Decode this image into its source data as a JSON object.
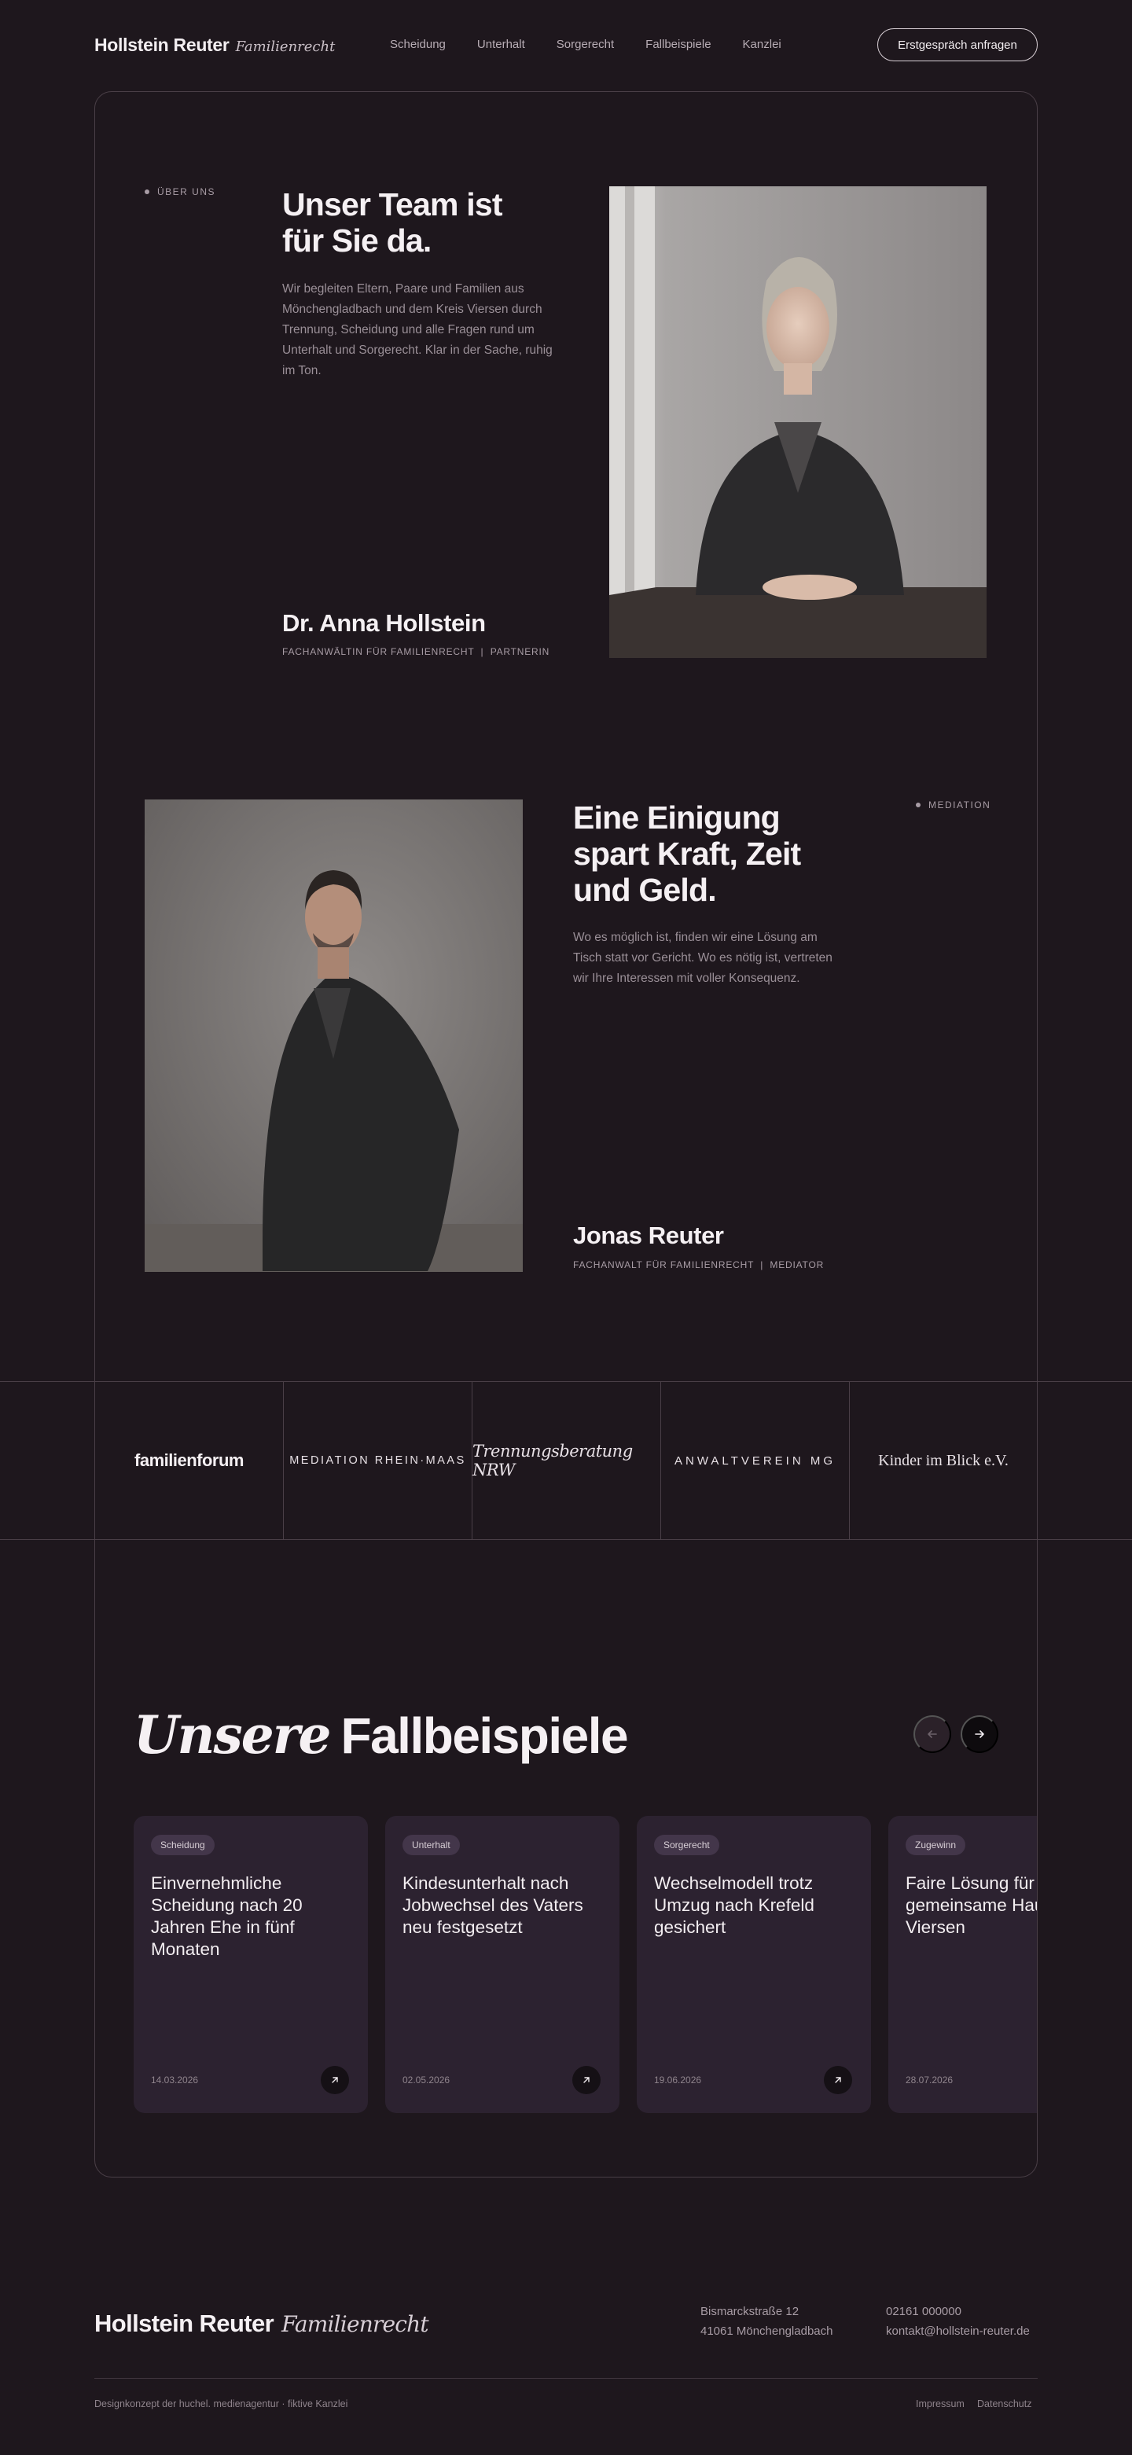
{
  "header": {
    "logo_name": "Hollstein Reuter",
    "logo_sub": "Familienrecht",
    "nav": [
      "Scheidung",
      "Unterhalt",
      "Sorgerecht",
      "Fallbeispiele",
      "Kanzlei"
    ],
    "cta": "Erstgespräch anfragen"
  },
  "about": {
    "eyebrow": "ÜBER UNS",
    "headline_1": "Unser Team ist",
    "headline_2": "für Sie da.",
    "text": "Wir begleiten Eltern, Paare und Familien aus Mönchengladbach und dem Kreis Viersen durch Trennung, Scheidung und alle Fragen rund um Unterhalt und Sorgerecht. Klar in der Sache, ruhig im Ton.",
    "name": "Dr. Anna Hollstein",
    "role": "FACHANWÄLTIN FÜR FAMILIENRECHT  |  PARTNERIN"
  },
  "mediation": {
    "eyebrow": "MEDIATION",
    "headline_1": "Eine Einigung",
    "headline_2": "spart Kraft, Zeit",
    "headline_3": "und Geld.",
    "text": "Wo es möglich ist, finden wir eine Lösung am Tisch statt vor Gericht. Wo es nötig ist, vertreten wir Ihre Interessen mit voller Konsequenz.",
    "name": "Jonas Reuter",
    "role": "FACHANWALT FÜR FAMILIENRECHT  |  MEDIATOR"
  },
  "partners": [
    "familienforum",
    "MEDIATION RHEIN·MAAS",
    "Trennungsberatung NRW",
    "ANWALTVEREIN MG",
    "Kinder im Blick e.V."
  ],
  "cases": {
    "title_italic": "Unsere",
    "title_bold": "Fallbeispiele",
    "items": [
      {
        "tag": "Scheidung",
        "title": "Einvernehmliche Scheidung nach 20 Jahren Ehe in fünf Monaten",
        "date": "14.03.2026"
      },
      {
        "tag": "Unterhalt",
        "title": "Kindesunterhalt nach Jobwechsel des Vaters neu festgesetzt",
        "date": "02.05.2026"
      },
      {
        "tag": "Sorgerecht",
        "title": "Wechselmodell trotz Umzug nach Krefeld gesichert",
        "date": "19.06.2026"
      },
      {
        "tag": "Zugewinn",
        "title": "Faire Lösung für das gemeinsame Haus in Viersen",
        "date": "28.07.2026"
      }
    ]
  },
  "footer": {
    "logo_name": "Hollstein Reuter",
    "logo_sub": "Familienrecht",
    "address_1": "Bismarckstraße 12",
    "address_2": "41061 Mönchengladbach",
    "phone": "02161 000000",
    "email": "kontakt@hollstein-reuter.de",
    "credit": "Designkonzept der huchel. medienagentur · fiktive Kanzlei",
    "impressum": "Impressum",
    "datenschutz": "Datenschutz"
  }
}
